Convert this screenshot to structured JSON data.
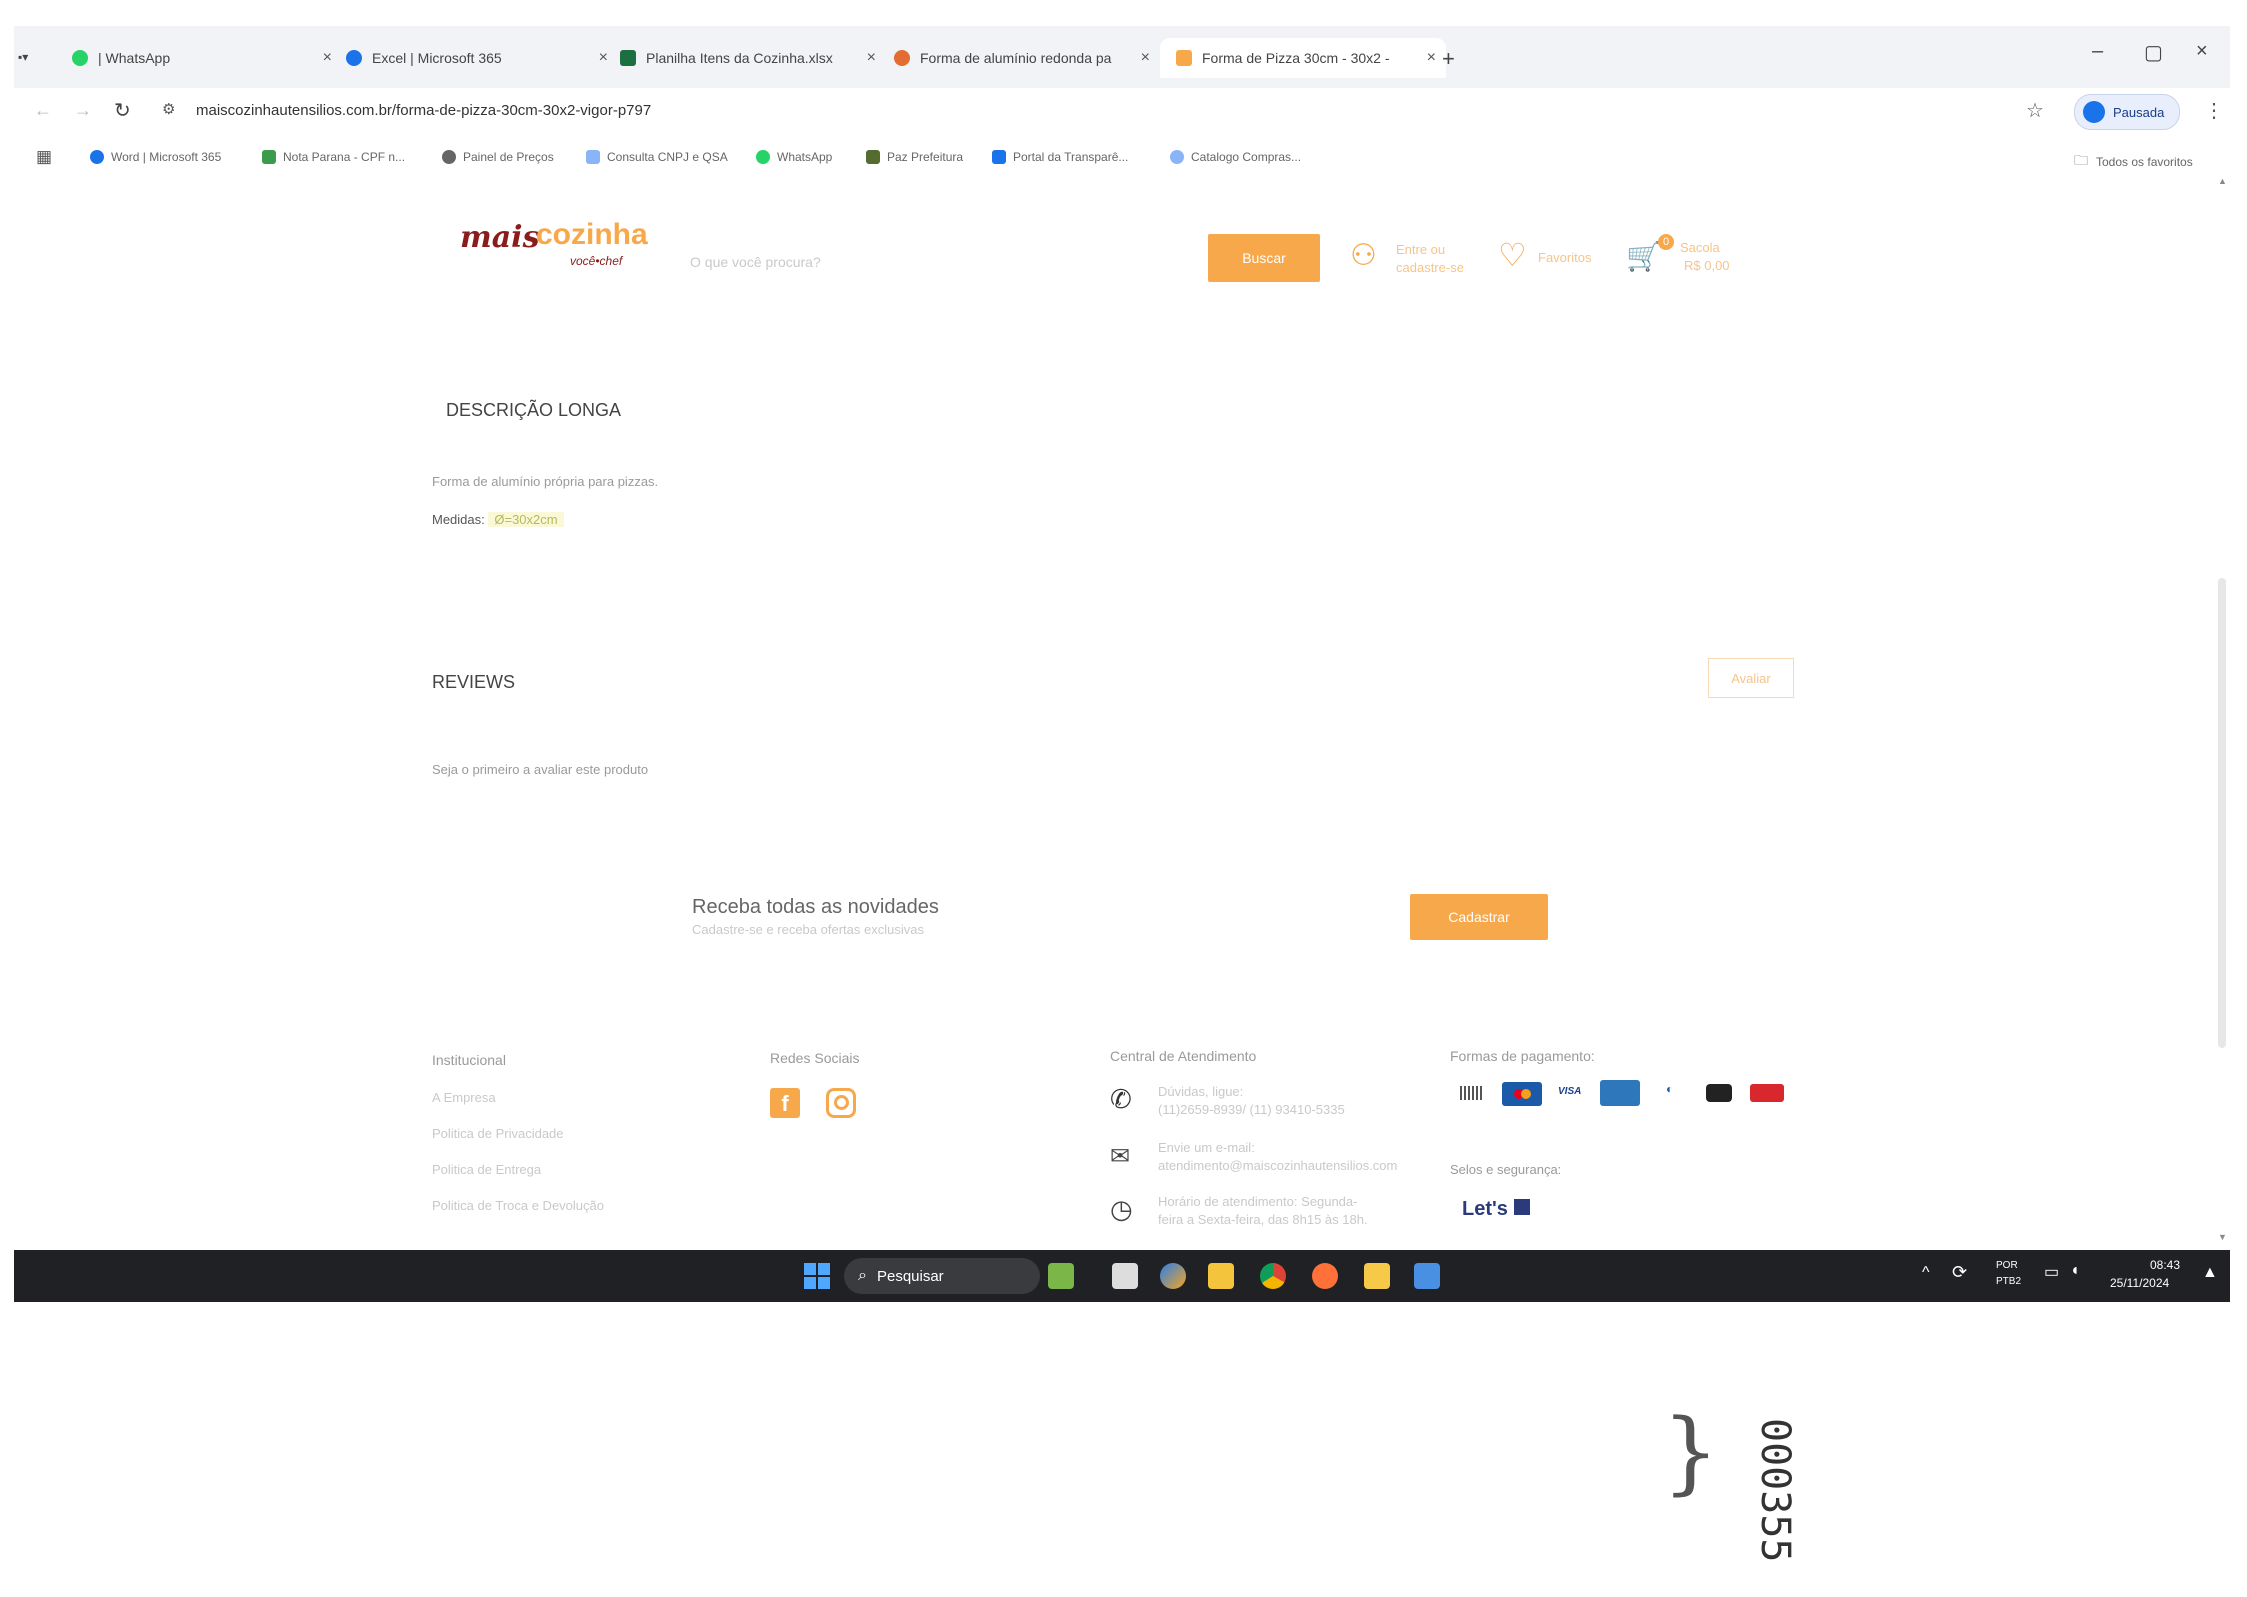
{
  "tabs": [
    {
      "label": "| WhatsApp",
      "color": "#25d366"
    },
    {
      "label": "Excel | Microsoft 365",
      "color": "#1a73e8"
    },
    {
      "label": "Planilha Itens da Cozinha.xlsx",
      "color": "#1d6f42"
    },
    {
      "label": "Forma de alumínio redonda pa",
      "color": "#e46b32"
    },
    {
      "label": "Forma de Pizza 30cm - 30x2 -",
      "color": "#f7a84a"
    }
  ],
  "address": {
    "url": "maiscozinhautensilios.com.br/forma-de-pizza-30cm-30x2-vigor-p797",
    "profile_label": "Pausada"
  },
  "bookmarks": [
    "Word | Microsoft 365",
    "Nota Parana - CPF n...",
    "Painel de Preços",
    "Consulta CNPJ e QSA",
    "WhatsApp",
    "Paz Prefeitura",
    "Portal da Transparê...",
    "Catalogo Compras..."
  ],
  "bookmarks_right": "Todos os favoritos",
  "header": {
    "logo_mais": "mais",
    "logo_cozinha": "cozinha",
    "logo_tagline": "você•chef",
    "search_placeholder": "O que você procura?",
    "search_button": "Buscar",
    "login_line1": "Entre ou",
    "login_line2": "cadastre-se",
    "favorites": "Favoritos",
    "cart_count": "0",
    "cart_label": "Sacola",
    "cart_total": "R$ 0,00"
  },
  "description": {
    "title": "DESCRIÇÃO LONGA",
    "text": "Forma de alumínio própria para pizzas.",
    "measures_label": "Medidas:",
    "measures_value": "Ø=30x2cm"
  },
  "reviews": {
    "title": "REVIEWS",
    "rate_button": "Avaliar",
    "empty_text": "Seja o primeiro a avaliar este produto"
  },
  "newsletter": {
    "title": "Receba todas as novidades",
    "subtitle": "Cadastre-se e receba ofertas exclusivas",
    "button": "Cadastrar"
  },
  "footer": {
    "institutional_title": "Institucional",
    "institutional_links": [
      "A Empresa",
      "Politica de Privacidade",
      "Politica de Entrega",
      "Politica de Troca e Devolução"
    ],
    "social_title": "Redes Sociais",
    "support_title": "Central de Atendimento",
    "support_phone_l1": "Dúvidas, ligue:",
    "support_phone_l2": "(11)2659-8939/ (11) 93410-5335",
    "support_email_l1": "Envie um e-mail:",
    "support_email_l2": "atendimento@maiscozinhautensilios.com",
    "support_hours_l1": "Horário de atendimento: Segunda-",
    "support_hours_l2": "feira a Sexta-feira, das 8h15 às 18h.",
    "payment_title": "Formas de pagamento:",
    "security_title": "Selos e segurança:",
    "lets_label": "Let's"
  },
  "taskbar": {
    "search_label": "Pesquisar",
    "lang_l1": "POR",
    "lang_l2": "PTB2",
    "time": "08:43",
    "date": "25/11/2024"
  },
  "stamp_number": "000355"
}
